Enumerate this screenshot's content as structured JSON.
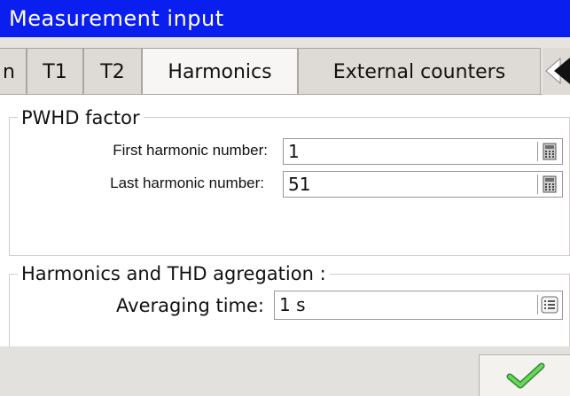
{
  "window": {
    "title": "Measurement input"
  },
  "tabs": [
    {
      "label": "n",
      "active": false
    },
    {
      "label": "T1",
      "active": false
    },
    {
      "label": "T2",
      "active": false
    },
    {
      "label": "Harmonics",
      "active": true
    },
    {
      "label": "External counters",
      "active": false
    }
  ],
  "pwhd": {
    "title": "PWHD factor",
    "first_label": "First harmonic number:",
    "first_value": "1",
    "last_label": "Last harmonic number:",
    "last_value": "51"
  },
  "aggregation": {
    "title": "Harmonics and THD agregation :",
    "averaging_label": "Averaging time:",
    "averaging_value": "1 s"
  },
  "icons": {
    "calculator": "calculator-icon",
    "list": "list-icon",
    "ok": "checkmark-icon",
    "more_tabs": "tab-scroll-right-icon"
  },
  "colors": {
    "titlebar": "#0b1ef0",
    "ok_check": "#4bb543"
  }
}
